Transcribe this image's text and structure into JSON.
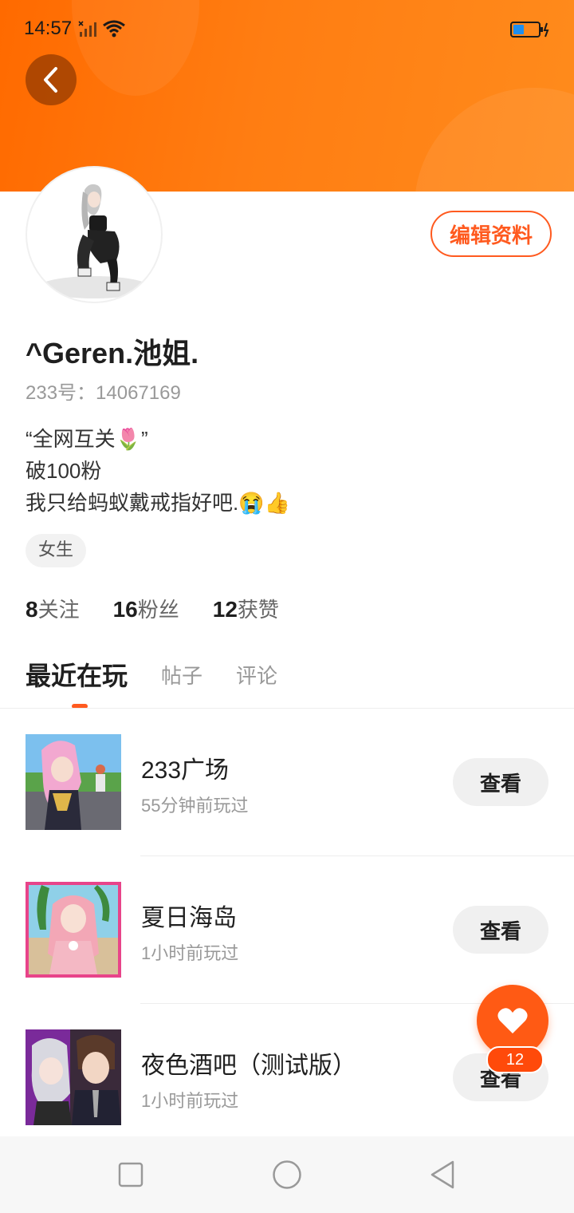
{
  "status_bar": {
    "time": "14:57"
  },
  "profile": {
    "username": "^Geren.池姐.",
    "uid_label": "233号：14067169",
    "bio_lines": [
      "“全网互关🌷”",
      "破100粉",
      "我只给蚂蚁戴戒指好吧.😭👍"
    ],
    "gender_tag": "女生",
    "edit_button": "编辑资料"
  },
  "stats": [
    {
      "count": "8",
      "label": "关注"
    },
    {
      "count": "16",
      "label": "粉丝"
    },
    {
      "count": "12",
      "label": "获赞"
    }
  ],
  "tabs": [
    {
      "label": "最近在玩",
      "active": true
    },
    {
      "label": "帖子",
      "active": false
    },
    {
      "label": "评论",
      "active": false
    }
  ],
  "games": [
    {
      "title": "233广场",
      "subtitle": "55分钟前玩过",
      "button": "查看"
    },
    {
      "title": "夏日海岛",
      "subtitle": "1小时前玩过",
      "button": "查看"
    },
    {
      "title": "夜色酒吧（测试版）",
      "subtitle": "1小时前玩过",
      "button": "查看"
    }
  ],
  "favorite": {
    "count": "12"
  },
  "colors": {
    "accent": "#ff5a1f",
    "header_start": "#ff6a00",
    "header_end": "#ff8b1c"
  }
}
